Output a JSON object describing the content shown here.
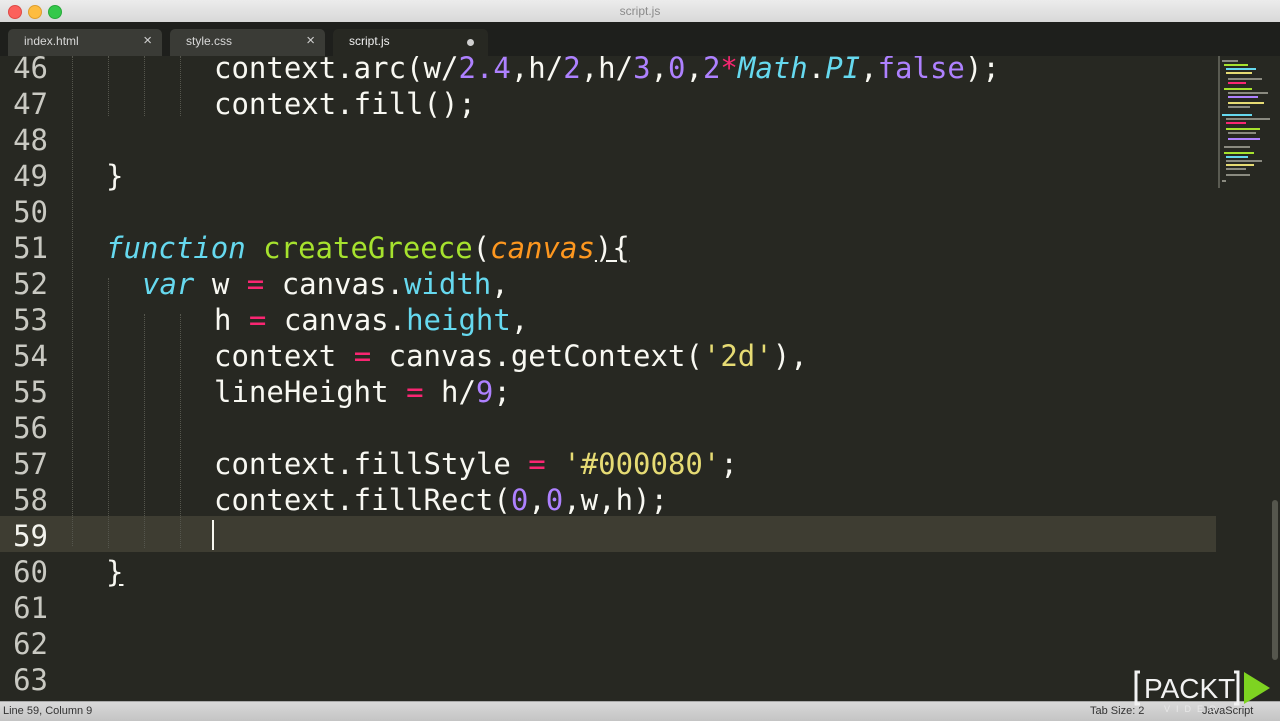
{
  "window": {
    "title": "script.js"
  },
  "tabs": [
    {
      "label": "index.html",
      "state": "close"
    },
    {
      "label": "style.css",
      "state": "close"
    },
    {
      "label": "script.js",
      "state": "modified",
      "active": true
    }
  ],
  "editor": {
    "current_line": 59,
    "lines": [
      {
        "number": "46",
        "tokens": []
      },
      {
        "number": "47",
        "tokens": []
      },
      {
        "number": "48",
        "tokens": []
      },
      {
        "number": "49",
        "tokens": []
      },
      {
        "number": "50",
        "tokens": []
      },
      {
        "number": "51",
        "tokens": []
      },
      {
        "number": "52",
        "tokens": []
      },
      {
        "number": "53",
        "tokens": []
      },
      {
        "number": "54",
        "tokens": []
      },
      {
        "number": "55",
        "tokens": []
      },
      {
        "number": "56",
        "tokens": []
      },
      {
        "number": "57",
        "tokens": []
      },
      {
        "number": "58",
        "tokens": []
      },
      {
        "number": "59",
        "tokens": []
      },
      {
        "number": "60",
        "tokens": []
      },
      {
        "number": "61",
        "tokens": []
      },
      {
        "number": "62",
        "tokens": []
      },
      {
        "number": "63",
        "tokens": []
      }
    ],
    "code": {
      "l46": [
        "context.arc(w/",
        "2.4",
        ",h/",
        "2",
        ",h/",
        "3",
        ",",
        "0",
        ",",
        "2",
        "*",
        "Math",
        ".",
        "PI",
        ",",
        "false",
        ");"
      ],
      "l47": "context.fill();",
      "l49": "}",
      "l51": [
        "function",
        " ",
        "createGreece",
        "(",
        "canvas",
        "){"
      ],
      "l52": [
        "var",
        " w ",
        "=",
        " canvas.",
        "width",
        ","
      ],
      "l53": [
        "h ",
        "=",
        " canvas.",
        "height",
        ","
      ],
      "l54": [
        "context ",
        "=",
        " canvas.getContext(",
        "'2d'",
        "),"
      ],
      "l55": [
        "lineHeight ",
        "=",
        " h/",
        "9",
        ";"
      ],
      "l57": [
        "context.fillStyle ",
        "=",
        " ",
        "'#000080'",
        ";"
      ],
      "l58": [
        "context.fillRect(",
        "0",
        ",",
        "0",
        ",w,h);"
      ],
      "l60": "}"
    }
  },
  "status": {
    "position": "Line 59, Column 9",
    "tab_size": "Tab Size: 2",
    "syntax": "JavaScript"
  },
  "logo": {
    "text": "PACKT",
    "subtext": "VIDEO"
  },
  "colors": {
    "background": "#272822",
    "keyword": "#66d9ef",
    "function_name": "#a6e22e",
    "parameter": "#fd971f",
    "operator": "#f92672",
    "number": "#ae81ff",
    "string": "#e6db74"
  }
}
